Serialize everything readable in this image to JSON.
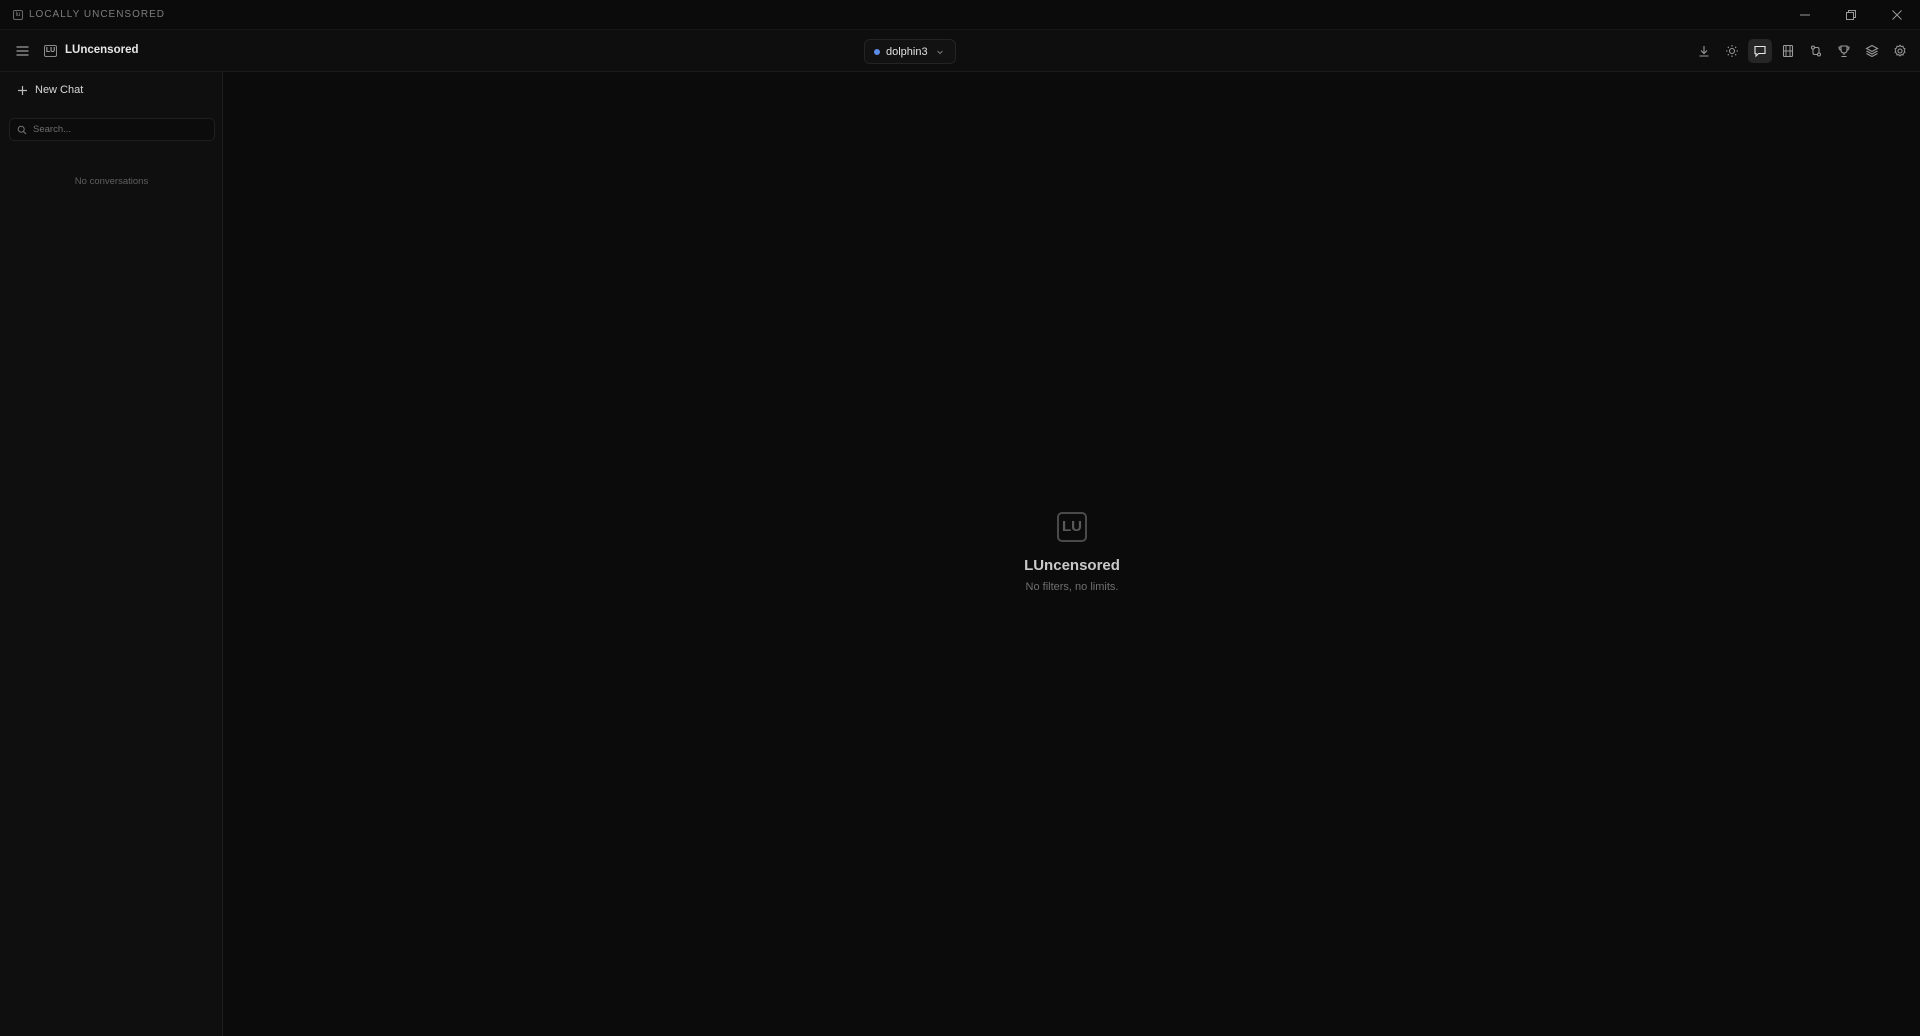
{
  "window": {
    "title": "LOCALLY UNCENSORED",
    "app_icon_text": "lu"
  },
  "header": {
    "brand_logo_text": "LU",
    "brand_name": "LUncensored",
    "model": {
      "name": "dolphin3",
      "status_color": "#5b8de8"
    },
    "toolbar": [
      {
        "icon": "download-icon",
        "active": false
      },
      {
        "icon": "sun-icon",
        "active": false
      },
      {
        "icon": "chat-icon",
        "active": true
      },
      {
        "icon": "film-icon",
        "active": false
      },
      {
        "icon": "compare-icon",
        "active": false
      },
      {
        "icon": "trophy-icon",
        "active": false
      },
      {
        "icon": "layers-icon",
        "active": false
      },
      {
        "icon": "gear-icon",
        "active": false
      }
    ]
  },
  "sidebar": {
    "new_chat_label": "New Chat",
    "search_placeholder": "Search...",
    "empty_text": "No conversations"
  },
  "main": {
    "logo_text": "LU",
    "title": "LUncensored",
    "subtitle": "No filters, no limits."
  },
  "colors": {
    "background": "#0b0b0b",
    "sidebar": "#0f0f0f",
    "accent": "#5b8de8"
  }
}
